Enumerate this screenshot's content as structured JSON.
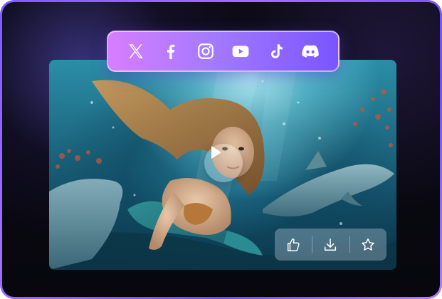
{
  "social_bar": {
    "items": [
      {
        "name": "x-twitter",
        "icon": "x-icon"
      },
      {
        "name": "facebook",
        "icon": "facebook-icon"
      },
      {
        "name": "instagram",
        "icon": "instagram-icon"
      },
      {
        "name": "youtube",
        "icon": "youtube-icon"
      },
      {
        "name": "tiktok",
        "icon": "tiktok-icon"
      },
      {
        "name": "discord",
        "icon": "discord-icon"
      }
    ]
  },
  "media": {
    "image_subject": "mermaid-underwater-with-dolphins",
    "play_icon": "play-icon"
  },
  "actions": {
    "items": [
      {
        "name": "like",
        "icon": "thumbs-up-icon"
      },
      {
        "name": "download",
        "icon": "download-icon"
      },
      {
        "name": "favorite",
        "icon": "star-icon"
      }
    ]
  },
  "colors": {
    "frame_border": "#8a63ff",
    "social_bar_start": "#d87dff",
    "social_bar_end": "#7a55ff",
    "background": "#07070d"
  }
}
